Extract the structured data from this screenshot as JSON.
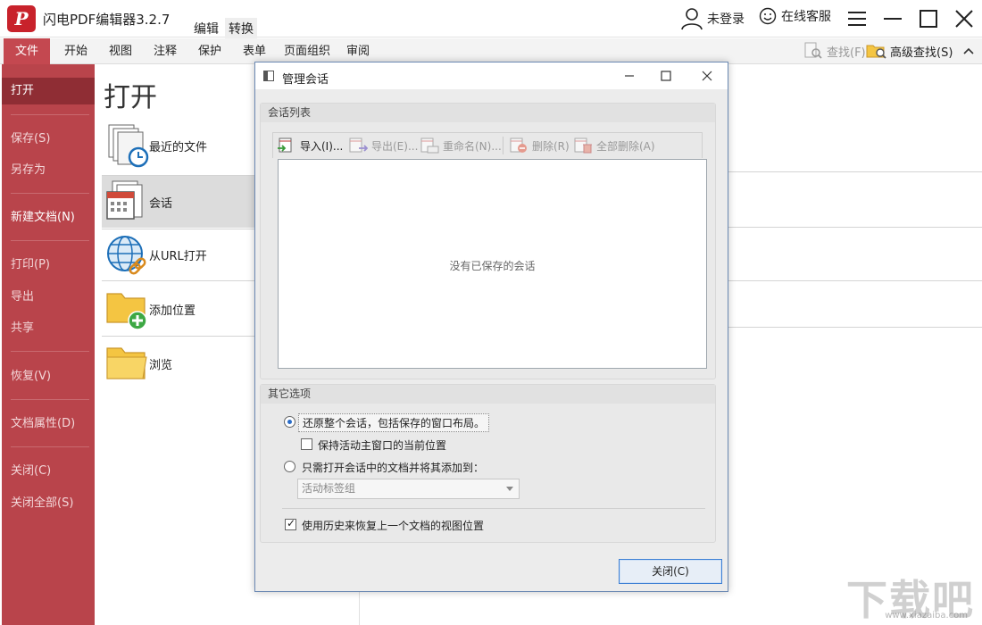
{
  "window": {
    "logo_letter": "P",
    "title": "闪电PDF编辑器3.2.7",
    "mode_tabs": [
      "编辑",
      "转换"
    ],
    "user_label": "未登录",
    "support_label": "在线客服"
  },
  "ribbon": {
    "tabs": [
      "文件",
      "开始",
      "视图",
      "注释",
      "保护",
      "表单",
      "页面组织",
      "审阅"
    ],
    "find_label": "查找(F)",
    "advanced_find_label": "高级查找(S)"
  },
  "leftmenu": {
    "open": "打开",
    "save": "保存(S)",
    "save_as": "另存为",
    "new_doc": "新建文档(N)",
    "print": "打印(P)",
    "export": "导出",
    "share": "共享",
    "restore": "恢复(V)",
    "doc_props": "文档属性(D)",
    "close": "关闭(C)",
    "close_all": "关闭全部(S)"
  },
  "open_panel": {
    "title": "打开",
    "items": [
      "最近的文件",
      "会话",
      "从URL打开",
      "添加位置",
      "浏览"
    ]
  },
  "dialog": {
    "title": "管理会话",
    "session_list_header": "会话列表",
    "toolbar": {
      "import": "导入(I)...",
      "export": "导出(E)...",
      "rename": "重命名(N)...",
      "delete": "删除(R)",
      "delete_all": "全部删除(A)"
    },
    "empty_text": "没有已保存的会话",
    "other_options_header": "其它选项",
    "option_restore_all": "还原整个会话，包括保存的窗口布局。",
    "option_keep_position": "保持活动主窗口的当前位置",
    "option_open_only": "只需打开会话中的文档并将其添加到：",
    "select_value": "活动标签组",
    "option_history": "使用历史来恢复上一个文档的视图位置",
    "close_button": "关闭(C)"
  },
  "watermark": {
    "text": "下载吧",
    "url": "www.xiazaiba.com"
  },
  "colors": {
    "accent_red": "#b9444b",
    "menu_active": "#8f2d34",
    "dialog_border": "#6b89b3",
    "button_focus": "#3c7fd4"
  }
}
